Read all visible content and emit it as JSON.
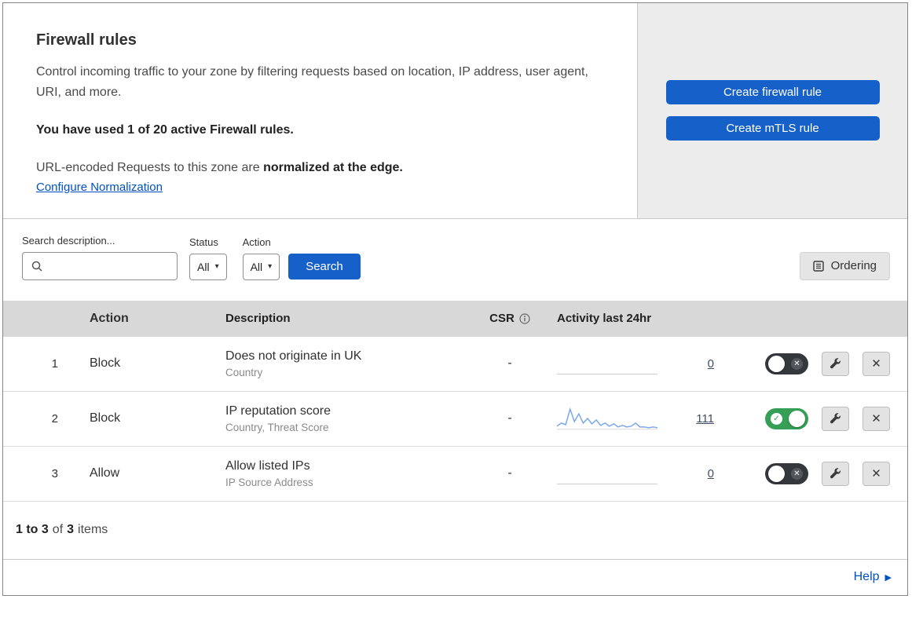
{
  "header": {
    "title": "Firewall rules",
    "description": "Control incoming traffic to your zone by filtering requests based on location, IP address, user agent, URI, and more.",
    "usage": "You have used 1 of 20 active Firewall rules.",
    "norm_prefix": "URL-encoded Requests to this zone are",
    "norm_bold": "normalized at the edge.",
    "configure_link": "Configure Normalization",
    "buttons": [
      {
        "label": "Create firewall rule"
      },
      {
        "label": "Create mTLS rule"
      }
    ]
  },
  "filters": {
    "search_label": "Search description...",
    "search_value": "",
    "status_label": "Status",
    "status_value": "All",
    "action_label": "Action",
    "action_value": "All",
    "search_button": "Search",
    "ordering_button": "Ordering"
  },
  "table": {
    "headers": {
      "action": "Action",
      "description": "Description",
      "csr": "CSR",
      "activity": "Activity last 24hr"
    },
    "rows": [
      {
        "index": "1",
        "action": "Block",
        "description": "Does not originate in UK",
        "subtitle": "Country",
        "csr": "-",
        "activity_count": "0",
        "enabled": false
      },
      {
        "index": "2",
        "action": "Block",
        "description": "IP reputation score",
        "subtitle": "Country, Threat Score",
        "csr": "-",
        "activity_count": "111",
        "enabled": true,
        "sparkline": [
          30,
          26,
          28,
          8,
          24,
          14,
          26,
          20,
          27,
          22,
          29,
          26,
          30,
          27,
          31,
          29,
          31,
          30,
          26,
          31,
          31,
          32,
          31,
          32
        ]
      },
      {
        "index": "3",
        "action": "Allow",
        "description": "Allow listed IPs",
        "subtitle": "IP Source Address",
        "csr": "-",
        "activity_count": "0",
        "enabled": false
      }
    ],
    "summary": {
      "range": "1 to 3",
      "of": "of",
      "total": "3",
      "items": "items"
    }
  },
  "help": {
    "label": "Help",
    "arrow": "▶"
  },
  "icons": {
    "caret": "▾",
    "check": "✓",
    "x": "✕",
    "close": "✕"
  },
  "colors": {
    "primary_blue": "#1660c9",
    "link_blue": "#0051c3",
    "toggle_green": "#35a055",
    "toggle_dark": "#34373c",
    "table_header_gray": "#d8d8d8",
    "panel_gray": "#ececec",
    "sparkline_blue": "#7aa7e9"
  }
}
